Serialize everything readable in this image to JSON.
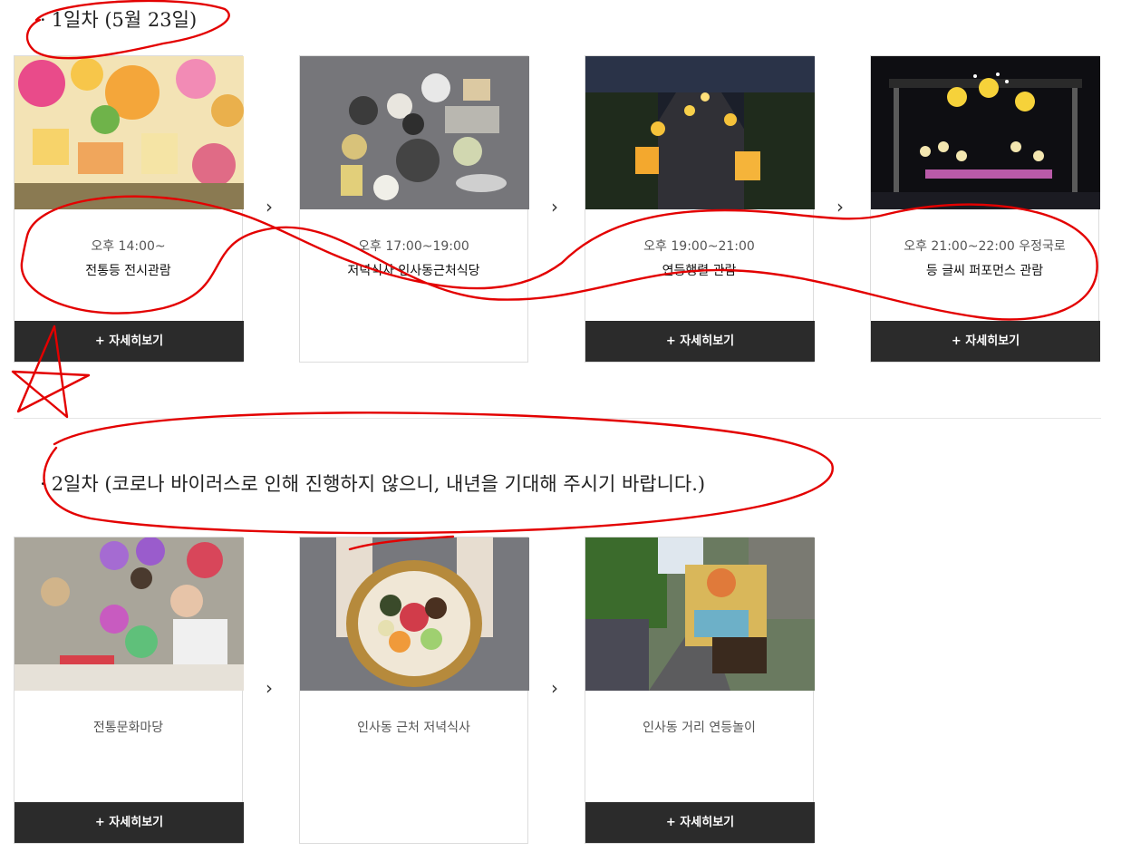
{
  "day1": {
    "title": "1일차 (5월 23일)",
    "cards": [
      {
        "time": "오후 14:00~",
        "name": "전통등 전시관람",
        "button": "+ 자세히보기"
      },
      {
        "time": "오후 17:00~19:00",
        "name": "저녁식사 인사동근처식당",
        "button": ""
      },
      {
        "time": "오후 19:00~21:00",
        "name": "연등행렬 관람",
        "button": "+ 자세히보기"
      },
      {
        "time": "오후 21:00~22:00 우정국로",
        "name": "등 글씨 퍼포먼스 관람",
        "button": "+ 자세히보기"
      }
    ]
  },
  "day2": {
    "title": "2일차 (코로나 바이러스로 인해 진행하지 않으니, 내년을 기대해 주시기 바랍니다.)",
    "cards": [
      {
        "name": "전통문화마당",
        "button": "+ 자세히보기"
      },
      {
        "name": "인사동 근처 저녁식사",
        "button": ""
      },
      {
        "name": "인사동 거리 연등놀이",
        "button": "+ 자세히보기"
      }
    ]
  },
  "arrow_glyph": "›",
  "bullet": "·",
  "colors": {
    "button_bg": "#2b2b2b",
    "annotation": "#e30000"
  }
}
